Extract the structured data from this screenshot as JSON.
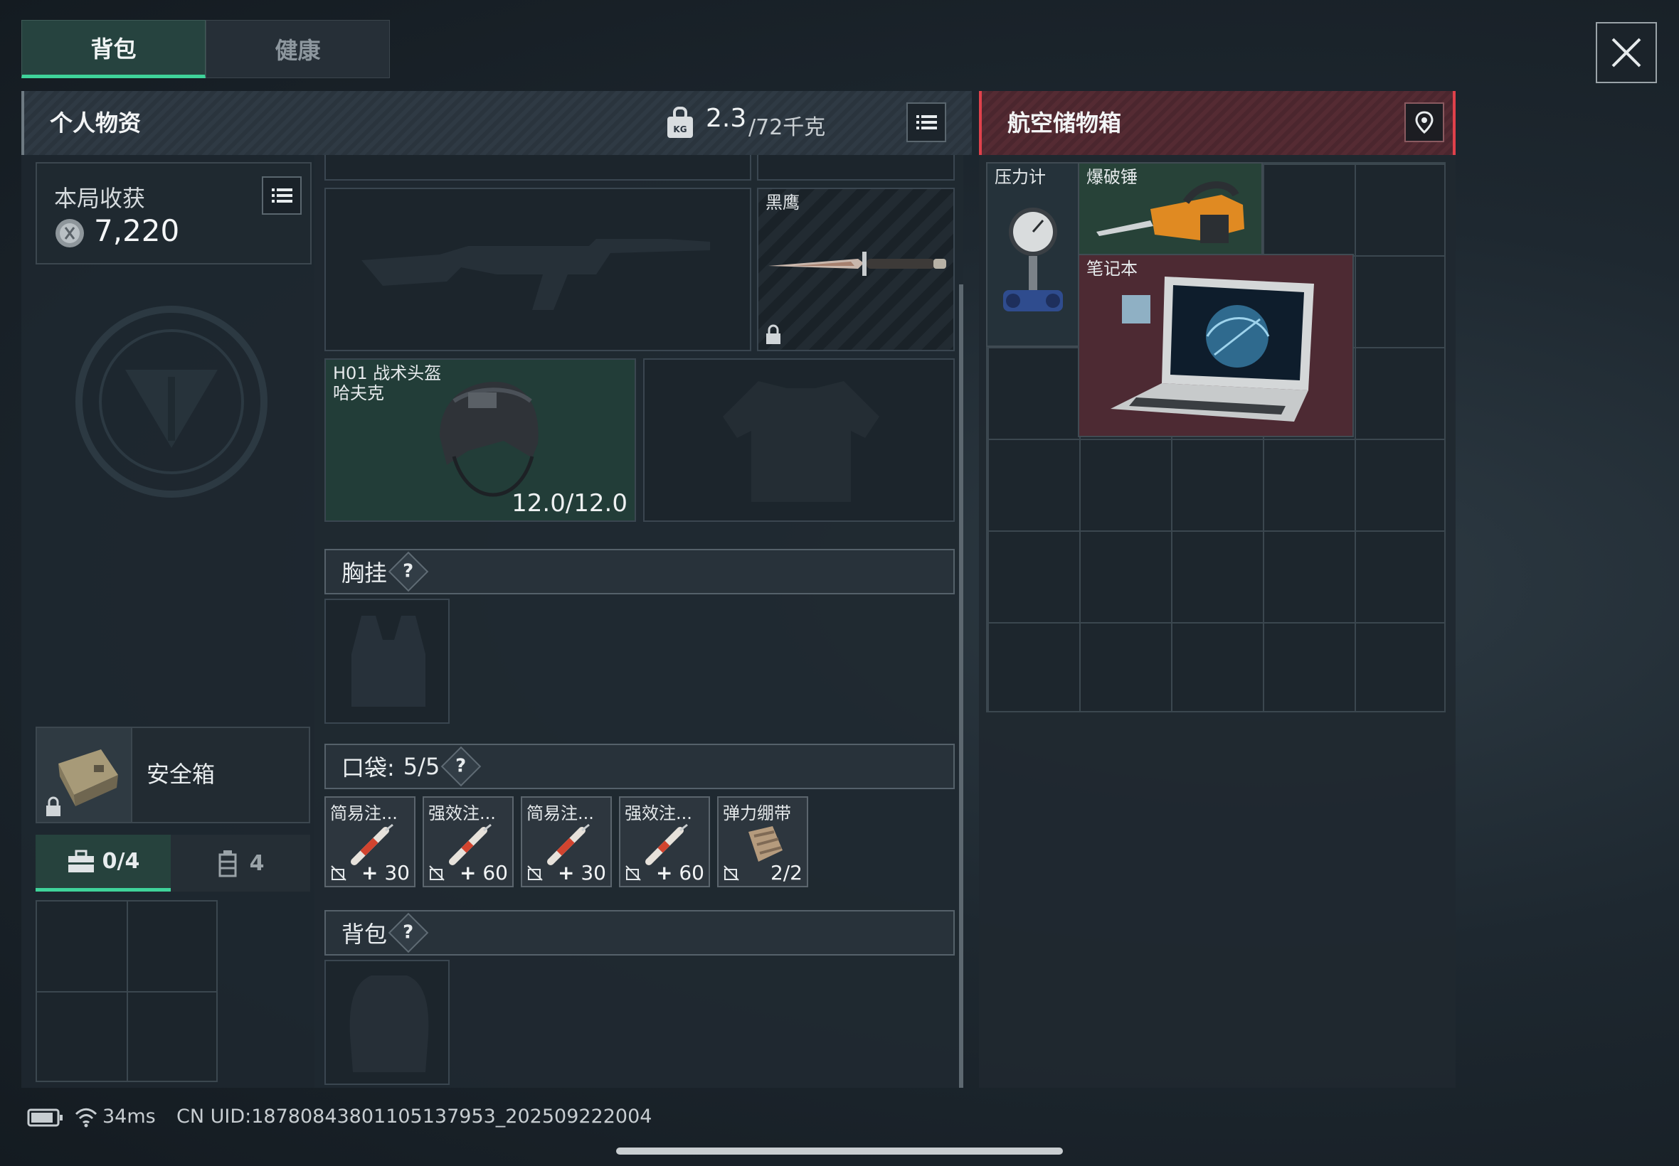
{
  "tabs": {
    "backpack": "背包",
    "health": "健康"
  },
  "personal": {
    "title": "个人物资",
    "weight_current": "2.3",
    "weight_max": "/72千克",
    "weight_icon": "kg-weight-icon"
  },
  "loot": {
    "label": "本局收获",
    "value": "7,220"
  },
  "slots": {
    "melee_name": "黑鹰",
    "helmet_name": "H01 战术头盔",
    "helmet_sub": "哈夫克",
    "helmet_durability": "12.0/12.0"
  },
  "sections": {
    "chest": "胸挂",
    "pocket_prefix": "口袋:",
    "pocket_count": "5/5",
    "backpack": "背包",
    "qmark": "?"
  },
  "pockets": [
    {
      "name": "简易注...",
      "plus": "+",
      "value": "30"
    },
    {
      "name": "强效注...",
      "plus": "+",
      "value": "60"
    },
    {
      "name": "简易注...",
      "plus": "+",
      "value": "30"
    },
    {
      "name": "强效注...",
      "plus": "+",
      "value": "60"
    },
    {
      "name": "弹力绷带",
      "plus": "",
      "value": "2/2"
    }
  ],
  "safebox": {
    "label": "安全箱",
    "tab1": "0/4",
    "tab2": "4"
  },
  "container": {
    "title": "航空储物箱",
    "items": {
      "gauge": "压力计",
      "hammer": "爆破锤",
      "laptop": "笔记本"
    }
  },
  "statusbar": {
    "ping": "34ms",
    "uid": "CN UID:18780843801105137953_202509222004"
  },
  "colors": {
    "accent": "#3fd39a",
    "container_red": "#e0414b"
  }
}
